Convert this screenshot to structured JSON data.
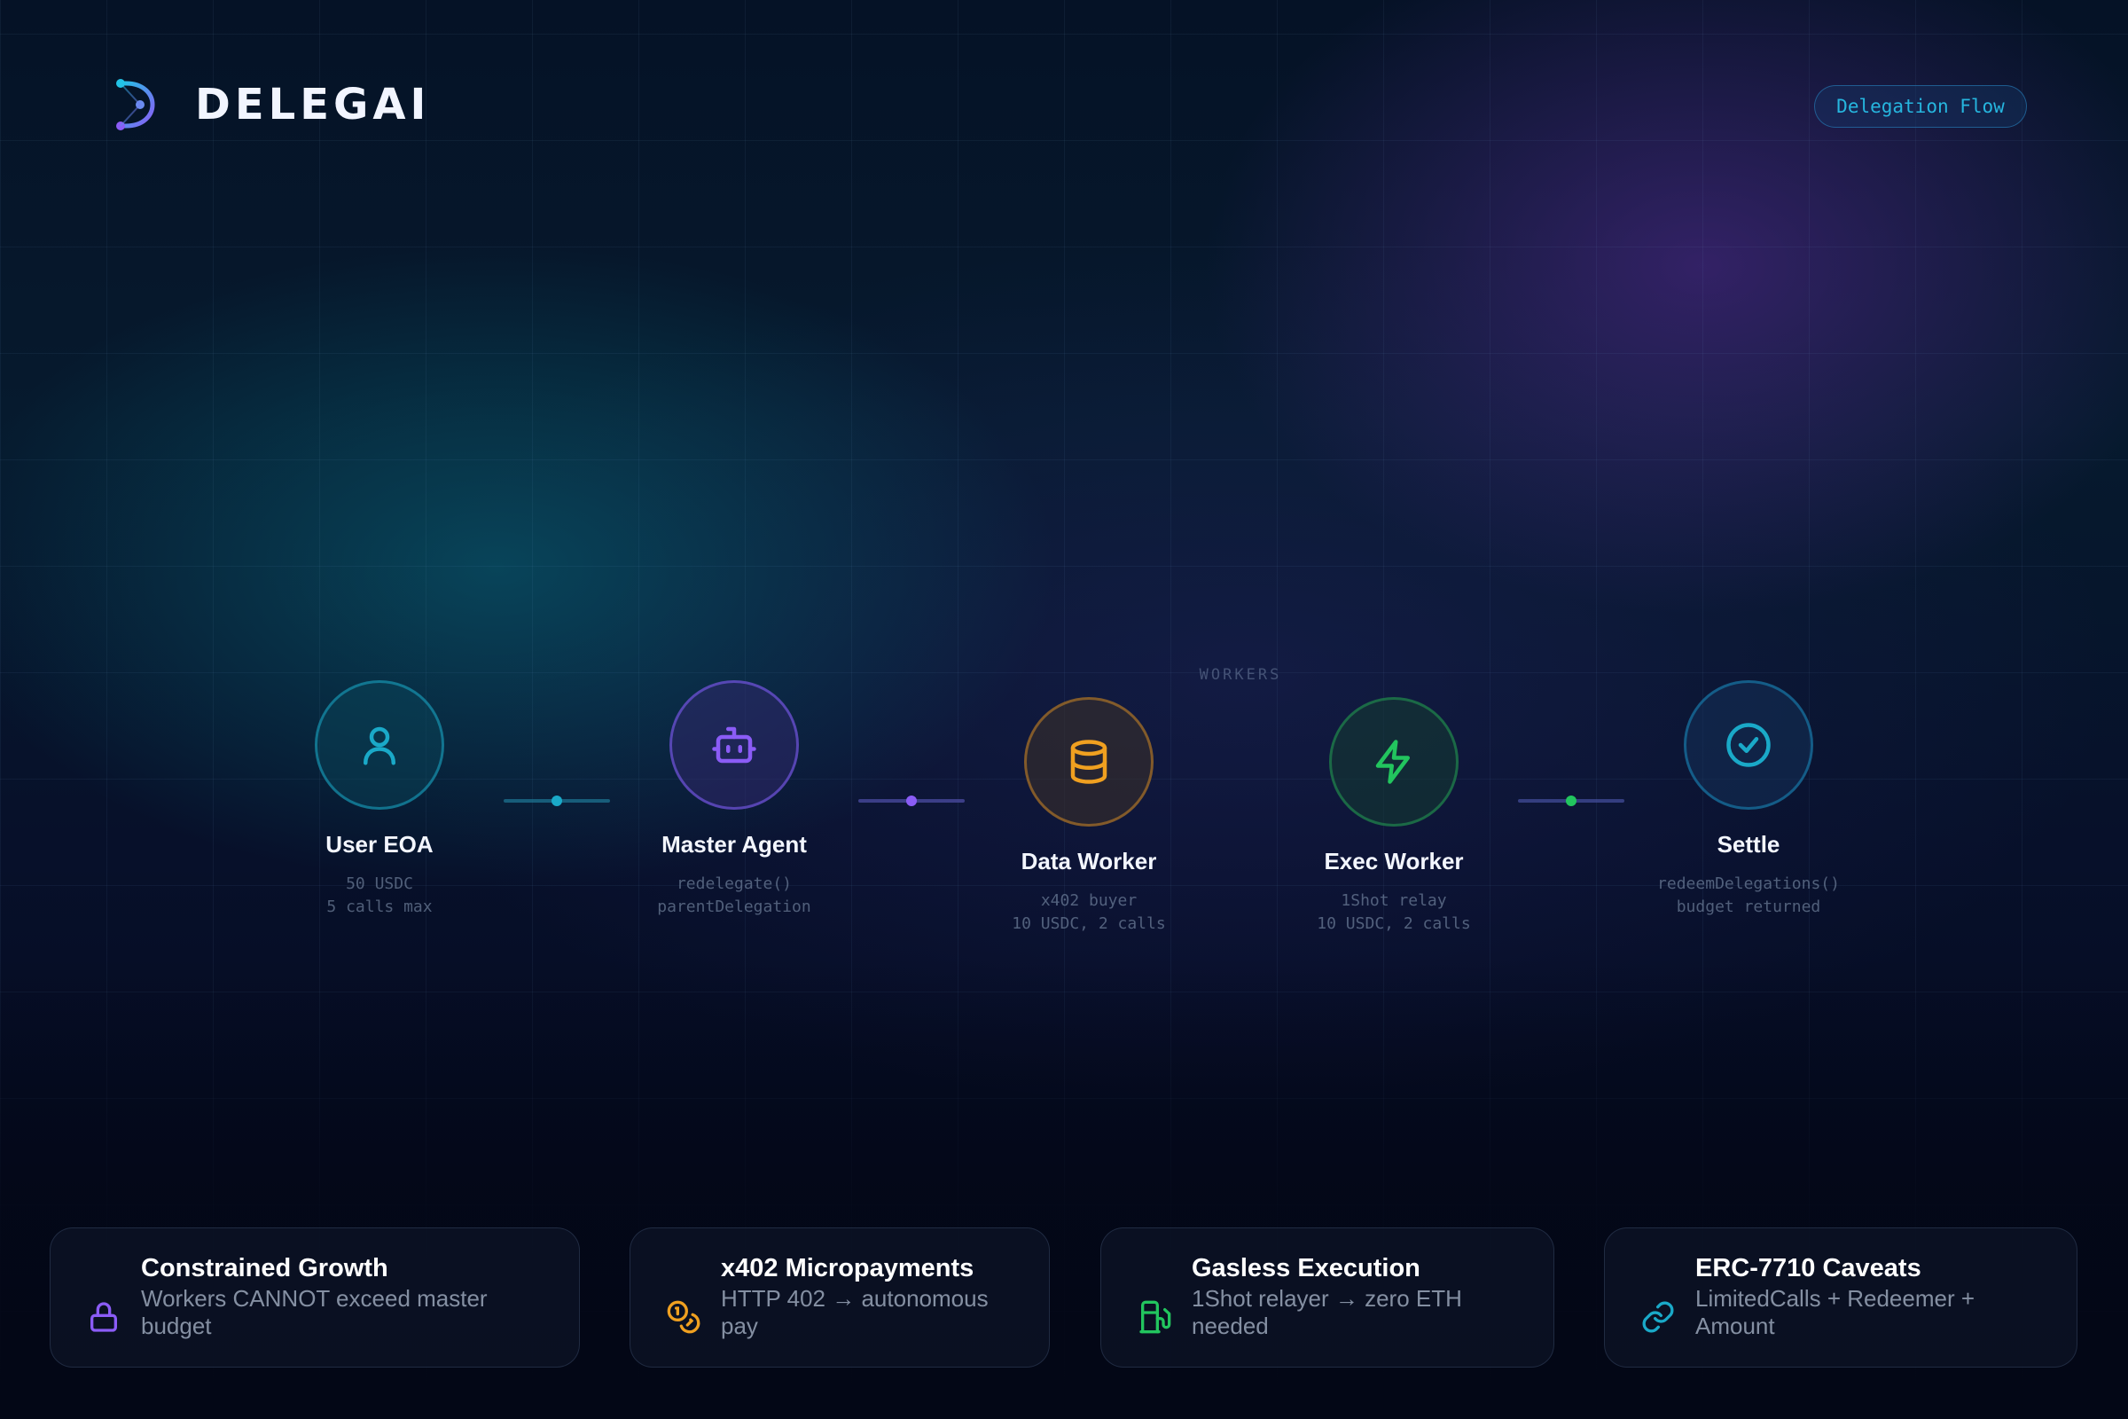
{
  "header": {
    "brand": "DELEGAI",
    "badge": "Delegation Flow"
  },
  "flow": {
    "group_label": "WORKERS",
    "nodes": [
      {
        "title": "User EOA",
        "lines": [
          "50 USDC",
          "5 calls max"
        ],
        "icon": "user-icon",
        "color": "#1aa9c8"
      },
      {
        "title": "Master Agent",
        "lines": [
          "redelegate()",
          "parentDelegation"
        ],
        "icon": "bot-icon",
        "color": "#7b5cf0"
      },
      {
        "title": "Data Worker",
        "lines": [
          "x402 buyer",
          "10 USDC, 2 calls"
        ],
        "icon": "database-icon",
        "color": "#f0a020"
      },
      {
        "title": "Exec Worker",
        "lines": [
          "1Shot relay",
          "10 USDC, 2 calls"
        ],
        "icon": "lightning-icon",
        "color": "#22c55e"
      },
      {
        "title": "Settle",
        "lines": [
          "redeemDelegations()",
          "budget returned"
        ],
        "icon": "check-circle-icon",
        "color": "#1aa9c8"
      }
    ]
  },
  "features": [
    {
      "title": "Constrained Growth",
      "desc": "Workers CANNOT exceed master budget",
      "icon": "lock-icon",
      "color": "#8b5cf6"
    },
    {
      "title": "x402 Micropayments",
      "desc": "HTTP 402 → autonomous pay",
      "icon": "coins-icon",
      "color": "#f0a020"
    },
    {
      "title": "Gasless Execution",
      "desc": "1Shot relayer → zero ETH needed",
      "icon": "fuel-pump-icon",
      "color": "#22c55e"
    },
    {
      "title": "ERC-7710 Caveats",
      "desc": "LimitedCalls + Redeemer + Amount",
      "icon": "link-icon",
      "color": "#1aa9c8"
    }
  ]
}
